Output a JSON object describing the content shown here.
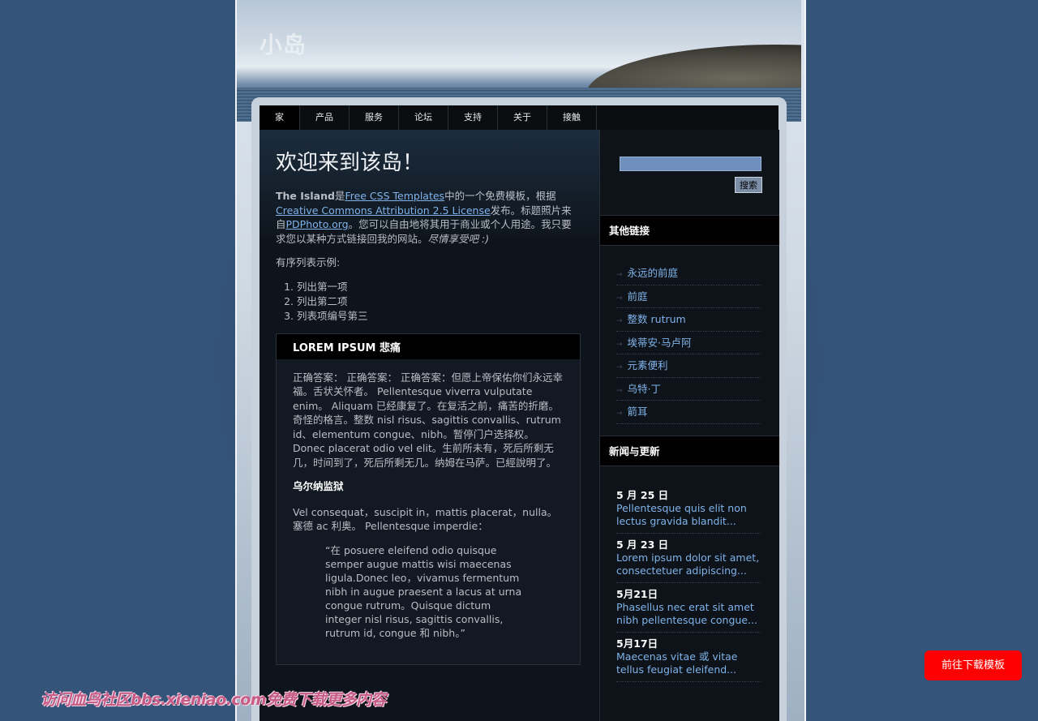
{
  "site": {
    "title": "小岛"
  },
  "menu": [
    {
      "label": "家",
      "active": true
    },
    {
      "label": "产品"
    },
    {
      "label": "服务"
    },
    {
      "label": "论坛"
    },
    {
      "label": "支持"
    },
    {
      "label": "关于"
    },
    {
      "label": "接触"
    }
  ],
  "main": {
    "heading": "欢迎来到该岛！",
    "intro": {
      "bold": "The Island",
      "t1": "是",
      "link1": "Free CSS Templates",
      "t2": "中的一个免费模板，根据",
      "link2": "Creative Commons Attribution 2.5 License",
      "t3": "发布。标题照片来自",
      "link3": "PDPhoto.org",
      "t4": "。您可以自由地将其用于商业或个人用途。我只要求您以某种方式链接回我的网站。",
      "italic": "尽情享受吧 :)"
    },
    "list_caption": "有序列表示例:",
    "list_items": [
      "列出第一项",
      "列出第二项",
      "列表项编号第三"
    ],
    "box": {
      "title": "LOREM IPSUM 悲痛",
      "para1": "正确答案： 正确答案： 正确答案：但愿上帝保佑你们永远幸福。舌状关怀者。 Pellentesque viverra vulputate enim。 Aliquam 已经康复了。在复活之前，痛苦的折磨。奇怪的格言。整数 nisl risus、sagittis convallis、rutrum id、elementum congue、nibh。暂停门户选择权。 Donec placerat odio vel elit。生前所未有，死后所剩无几，时间到了，死后所剩无几。纳姆在马萨。已經說明了。",
      "subheading": "乌尔纳监狱",
      "para2": "Vel consequat，suscipit in，mattis placerat，nulla。塞德 ac 利奥。 Pellentesque imperdie：",
      "quote": "“在 posuere eleifend odio quisque semper augue mattis wisi maecenas ligula.Donec leo，vivamus fermentum nibh in augue praesent a lacus at urna congue rutrum。Quisque dictum integer nisl risus, sagittis convallis, rutrum id, congue 和 nibh。”"
    }
  },
  "sidebar": {
    "search_button": "搜索",
    "search_value": "",
    "links_title": "其他链接",
    "links": [
      "永远的前庭",
      "前庭",
      "整数 rutrum",
      "埃蒂安·马卢阿",
      "元素便利",
      "乌特·丁",
      "箭耳"
    ],
    "news_title": "新闻与更新",
    "news": [
      {
        "date": "5 月 25 日",
        "text": "Pellentesque quis elit non lectus gravida blandit..."
      },
      {
        "date": "5 月 23 日",
        "text": "Lorem ipsum dolor sit amet, consectetuer adipiscing..."
      },
      {
        "date": "5月21日",
        "text": "Phasellus nec erat sit amet nibh pellentesque congue..."
      },
      {
        "date": "5月17日",
        "text": "Maecenas vitae 或 vitae tellus feugiat eleifend..."
      }
    ]
  },
  "overlay": {
    "download_button": "前往下载模板",
    "watermark": "访问血鸟社区bbs.xieniao.com免费下载更多内容"
  },
  "icons": {
    "list_bullet": "arrow-bullet-icon"
  }
}
